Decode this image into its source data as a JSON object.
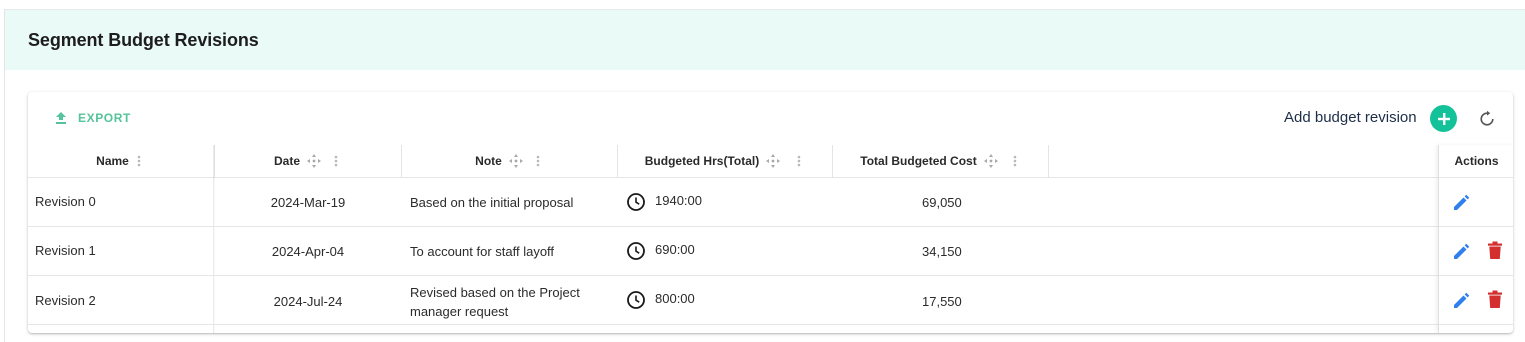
{
  "page": {
    "title": "Segment Budget Revisions"
  },
  "toolbar": {
    "export_label": "EXPORT",
    "add_label": "Add budget revision"
  },
  "table": {
    "columns": {
      "name": "Name",
      "date": "Date",
      "note": "Note",
      "hours": "Budgeted Hrs(Total)",
      "cost": "Total Budgeted Cost",
      "actions": "Actions"
    },
    "rows": [
      {
        "name": "Revision 0",
        "date": "2024-Mar-19",
        "note_line1": "Based on the initial proposal",
        "note_line2": "",
        "hours": "1940:00",
        "cost": "69,050",
        "can_delete": false
      },
      {
        "name": "Revision 1",
        "date": "2024-Apr-04",
        "note_line1": "To account for staff layoff",
        "note_line2": "",
        "hours": "690:00",
        "cost": "34,150",
        "can_delete": true
      },
      {
        "name": "Revision 2",
        "date": "2024-Jul-24",
        "note_line1": "Revised based on the Project",
        "note_line2": "manager request",
        "hours": "800:00",
        "cost": "17,550",
        "can_delete": true
      }
    ]
  },
  "icons": {
    "export": "upload-icon",
    "add": "plus-circle-icon",
    "refresh": "refresh-icon",
    "column_move": "move-icon",
    "column_menu": "vertical-dots-icon",
    "hours": "clock-icon",
    "edit": "pencil-icon",
    "delete": "trash-icon"
  },
  "colors": {
    "header_band": "#eafaf7",
    "accent": "#14c29a",
    "export_text": "#55c49c",
    "edit_icon": "#2f80ed",
    "delete_icon": "#d32f2f"
  }
}
